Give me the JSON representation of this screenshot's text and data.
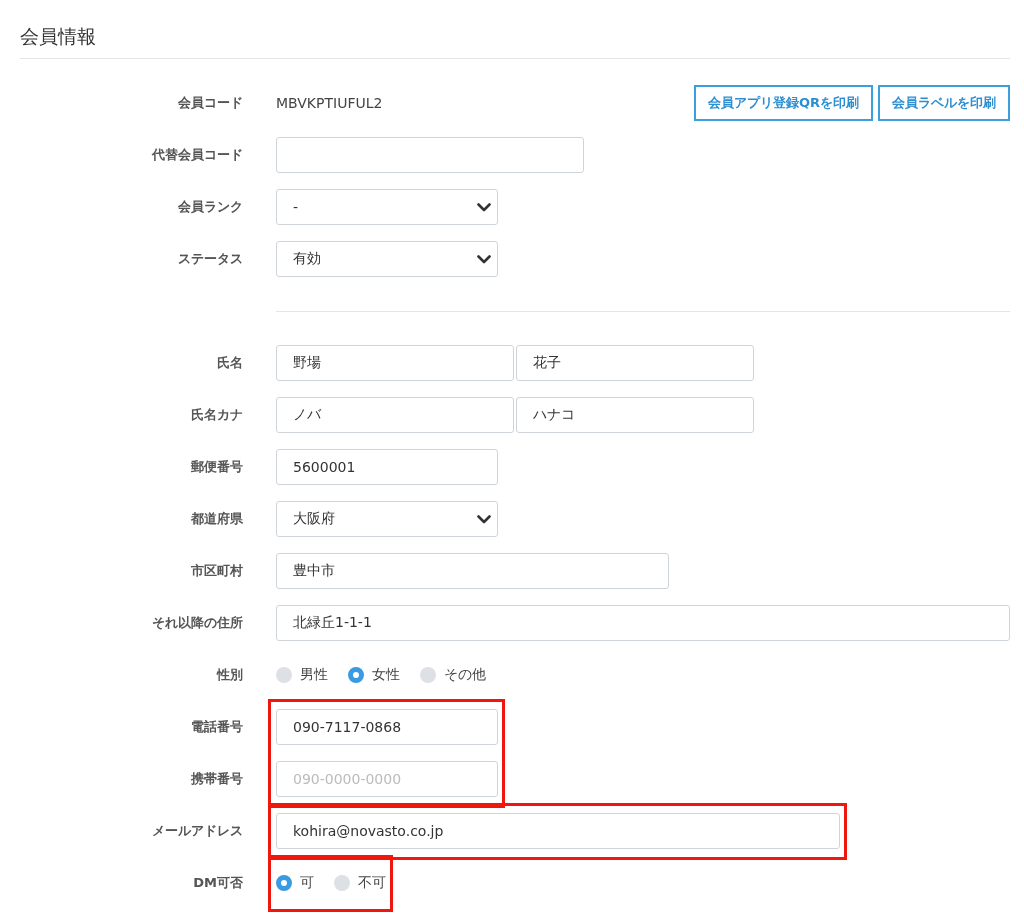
{
  "title": "会員情報",
  "groups": [
    {
      "highlighted": false,
      "rows": [
        {
          "kind": "text",
          "label": "会員コード",
          "value": "MBVKPTIUFUL2",
          "buttons": [
            "会員アプリ登録QRを印刷",
            "会員ラベルを印刷"
          ]
        },
        {
          "kind": "input",
          "label": "代替会員コード"
        },
        {
          "kind": "select",
          "label": "会員ランク",
          "value": "-"
        },
        {
          "kind": "select",
          "label": "ステータス",
          "value": "有効"
        },
        {
          "kind": "divider"
        },
        {
          "kind": "pair",
          "label": "氏名",
          "values": [
            "野場",
            "花子"
          ]
        },
        {
          "kind": "pair",
          "label": "氏名カナ",
          "values": [
            "ノバ",
            "ハナコ"
          ]
        },
        {
          "kind": "input",
          "label": "郵便番号",
          "value": "5600001"
        },
        {
          "kind": "select",
          "label": "都道府県",
          "value": "大阪府"
        },
        {
          "kind": "input",
          "label": "市区町村",
          "value": "豊中市"
        },
        {
          "kind": "input",
          "label": "それ以降の住所",
          "value": "北緑丘1-1-1"
        },
        {
          "kind": "radio",
          "label": "性別",
          "options": [
            {
              "label": "男性",
              "selected": false
            },
            {
              "label": "女性",
              "selected": true
            },
            {
              "label": "その他",
              "selected": false
            }
          ]
        }
      ]
    },
    {
      "highlighted": true,
      "rows": [
        {
          "kind": "input",
          "label": "電話番号",
          "value": "090-7117-0868"
        },
        {
          "kind": "input",
          "label": "携帯番号",
          "placeholder": "090-0000-0000"
        }
      ]
    },
    {
      "highlighted": true,
      "rows": [
        {
          "kind": "input",
          "label": "メールアドレス",
          "value": "kohira@novasto.co.jp"
        }
      ]
    },
    {
      "highlighted": true,
      "rows": [
        {
          "kind": "radio",
          "label": "DM可否",
          "options": [
            {
              "label": "可",
              "selected": true
            },
            {
              "label": "不可",
              "selected": false
            }
          ]
        }
      ]
    }
  ]
}
